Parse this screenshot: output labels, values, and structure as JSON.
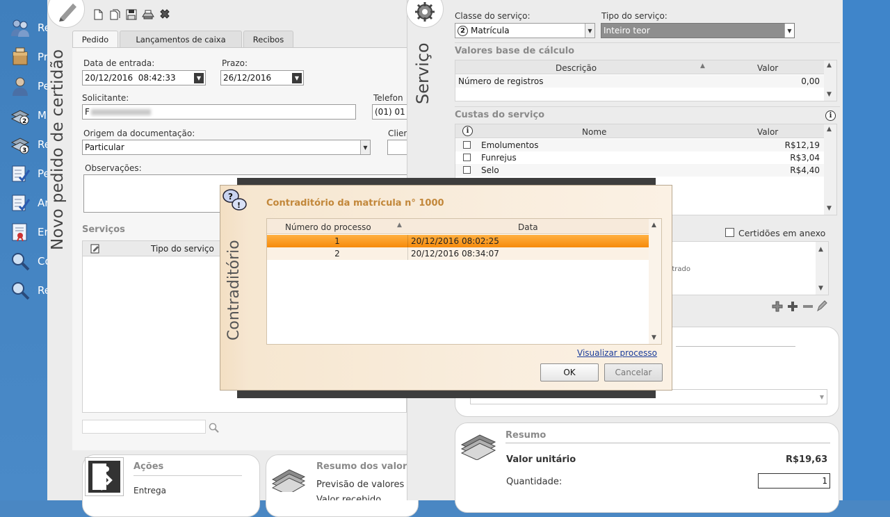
{
  "desktop": {
    "items": [
      {
        "label": "Re",
        "icon": "users-icon"
      },
      {
        "label": "Pr",
        "icon": "box-icon"
      },
      {
        "label": "Pe",
        "icon": "person-icon"
      },
      {
        "label": "M",
        "icon": "stack-2-icon"
      },
      {
        "label": "Re",
        "icon": "stack-3-icon"
      },
      {
        "label": "Pe",
        "icon": "checklist-icon"
      },
      {
        "label": "Ar",
        "icon": "checklist-icon"
      },
      {
        "label": "Er",
        "icon": "certificate-icon"
      },
      {
        "label": "Co",
        "icon": "magnifier-icon"
      },
      {
        "label": "Re",
        "icon": "magnifier-icon"
      }
    ]
  },
  "left_window": {
    "side_title": "Novo pedido de certidão",
    "tabs": [
      "Pedido",
      "Lançamentos de caixa",
      "Recibos"
    ],
    "data_entrada_label": "Data de entrada:",
    "data_entrada_value": "20/12/2016  08:42:33",
    "prazo_label": "Prazo:",
    "prazo_value": "26/12/2016",
    "solicitante_label": "Solicitante:",
    "solicitante_value": "F",
    "telefone_label": "Telefon",
    "telefone_value": "(01) 01",
    "origem_label": "Origem da documentação:",
    "origem_value": "Particular",
    "cliente_label": "Clier",
    "observacoes_label": "Observações:",
    "servicos_label": "Serviços",
    "servicos_col": "Tipo do serviço",
    "acoes_title": "Ações",
    "acoes_item": "Entrega",
    "resumo_valores_title": "Resumo dos valor",
    "previsao_label": "Previsão de valores",
    "valor_recebido_label": "Valor recebido"
  },
  "right_window": {
    "side_title": "Serviço",
    "classe_label": "Classe do serviço:",
    "classe_value": "Matrícula",
    "classe_badge": "2",
    "tipo_label": "Tipo do serviço:",
    "tipo_value": "Inteiro teor",
    "valores_base_title": "Valores base de cálculo",
    "valores_cols": [
      "Descrição",
      "Valor"
    ],
    "valores_rows": [
      {
        "descricao": "Número de registros",
        "valor": "0,00"
      }
    ],
    "custas_title": "Custas do serviço",
    "custas_cols": [
      "Nome",
      "Valor"
    ],
    "custas_rows": [
      {
        "nome": "Emolumentos",
        "valor": "R$12,19",
        "checked": false
      },
      {
        "nome": "Funrejus",
        "valor": "R$3,04",
        "checked": false
      },
      {
        "nome": "Selo",
        "valor": "R$4,40",
        "checked": false
      }
    ],
    "certidoes_label": "Certidões em anexo",
    "obs_fragment": "ntrado",
    "resumo_title": "Resumo",
    "valor_unitario_label": "Valor unitário",
    "valor_unitario_value": "R$19,63",
    "quantidade_label": "Quantidade:",
    "quantidade_value": "1"
  },
  "dialog": {
    "side_title": "Contraditório",
    "title": "Contraditório da matrícula n° 1000",
    "columns": [
      "Número do processo",
      "Data"
    ],
    "rows": [
      {
        "numero": "1",
        "data": "20/12/2016 08:02:25",
        "selected": true
      },
      {
        "numero": "2",
        "data": "20/12/2016 08:34:07",
        "selected": false
      }
    ],
    "link": "Visualizar processo",
    "ok": "OK",
    "cancel": "Cancelar"
  }
}
